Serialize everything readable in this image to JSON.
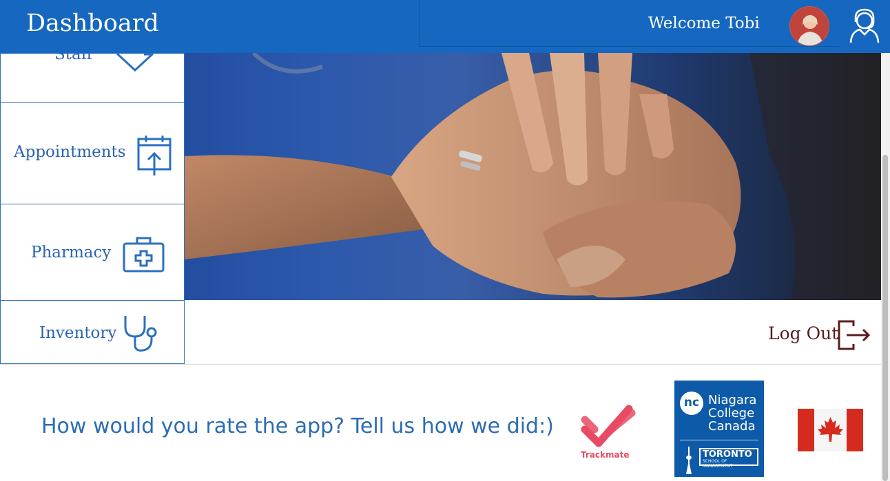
{
  "header": {
    "title": "Dashboard",
    "welcome": "Welcome Tobi"
  },
  "sidebar": {
    "items": [
      {
        "label": "Staff",
        "icon": "staff-icon"
      },
      {
        "label": "Appointments",
        "icon": "calendar-icon"
      },
      {
        "label": "Pharmacy",
        "icon": "medical-kit-icon"
      },
      {
        "label": "Inventory",
        "icon": "stethoscope-icon"
      }
    ]
  },
  "actions": {
    "logout": "Log Out"
  },
  "footer": {
    "rating_prompt": "How would you rate the app? Tell us how we did:)",
    "trackmate": "Trackmate",
    "nc_logo": {
      "badge": "nc",
      "line1": "Niagara",
      "line2": "College",
      "line3": "Canada",
      "campus": "TORONTO",
      "campus_sub": "SCHOOL OF MANAGEMENT"
    }
  },
  "colors": {
    "header": "#1667bf",
    "sidebar_text": "#2a63b3",
    "logout_text": "#5a1c1c",
    "rating_text": "#2b6cb3",
    "trackmate": "#e94a63"
  }
}
